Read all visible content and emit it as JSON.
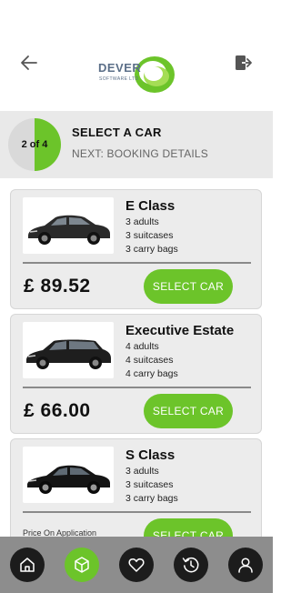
{
  "header": {
    "back_icon": "arrow-left-icon",
    "logout_icon": "logout-icon",
    "logo": {
      "line1": "DEVER",
      "line2": "SOFTWARE LTD",
      "accent": "#6cc42a"
    }
  },
  "step": {
    "progress_label": "2 of 4",
    "title": "SELECT A CAR",
    "next": "NEXT: BOOKING DETAILS",
    "current": 2,
    "total": 4
  },
  "colors": {
    "accent": "#6cc42a",
    "nav_bg": "#8d8d8d",
    "nav_button": "#1c1c1c",
    "card_bg": "#ececec"
  },
  "cars": [
    {
      "name": "E Class",
      "adults": "3 adults",
      "suitcases": "3 suitcases",
      "bags": "3 carry bags",
      "price": "£ 89.52",
      "button": "SELECT CAR"
    },
    {
      "name": "Executive Estate",
      "adults": "4 adults",
      "suitcases": "4 suitcases",
      "bags": "4 carry bags",
      "price": "£ 66.00",
      "button": "SELECT CAR"
    },
    {
      "name": "S Class",
      "adults": "3 adults",
      "suitcases": "3 suitcases",
      "bags": "3 carry bags",
      "price": "Price On Application",
      "button": "SELECT CAR"
    }
  ],
  "nav": [
    {
      "icon": "home-icon",
      "active": false
    },
    {
      "icon": "box-icon",
      "active": true
    },
    {
      "icon": "heart-icon",
      "active": false
    },
    {
      "icon": "history-icon",
      "active": false
    },
    {
      "icon": "user-icon",
      "active": false
    }
  ]
}
